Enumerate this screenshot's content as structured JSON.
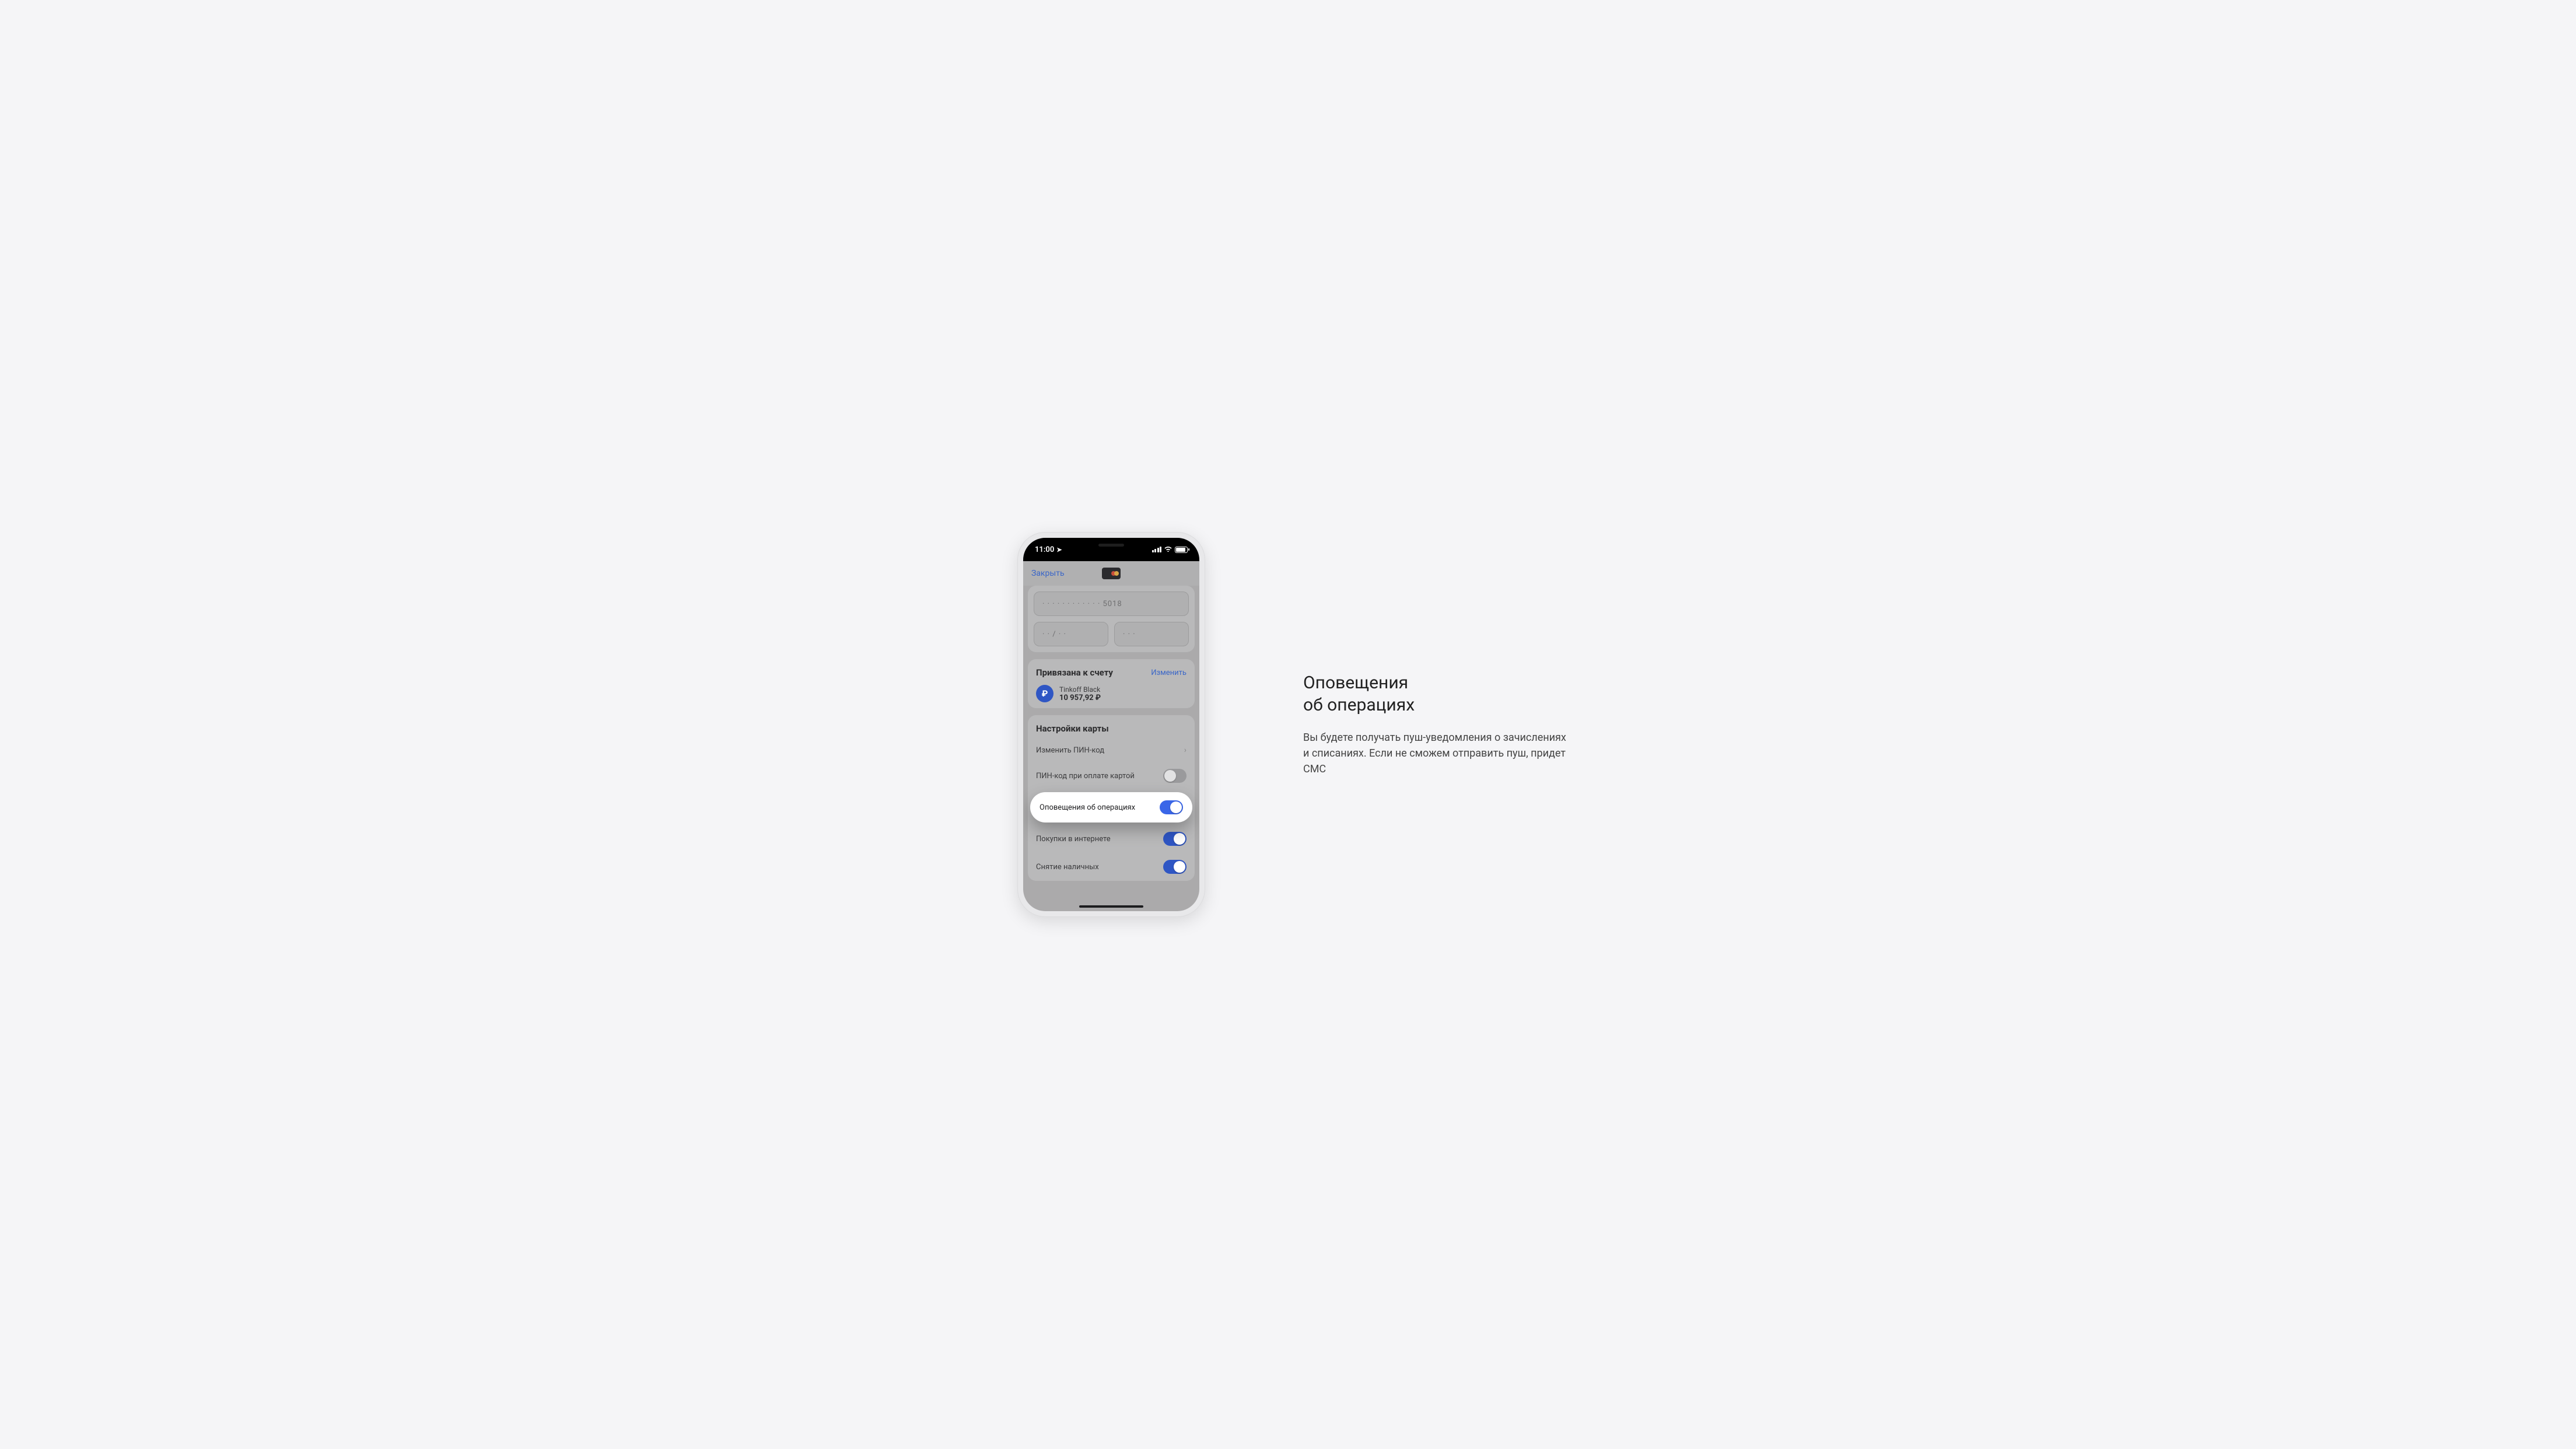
{
  "status": {
    "time": "11:00"
  },
  "nav": {
    "close_label": "Закрыть"
  },
  "card": {
    "pan_masked": "· · · ·   · · · ·   · · · · 5018",
    "expiry_masked": "· · / · ·",
    "cvv_masked": "· · ·"
  },
  "linked": {
    "title": "Привязана к счету",
    "change_label": "Изменить",
    "ruble_symbol": "₽",
    "account_name": "Tinkoff Black",
    "balance": "10 957,92 ₽"
  },
  "settings": {
    "title": "Настройки карты",
    "change_pin": "Изменить ПИН-код",
    "pin_on_pay": "ПИН-код при оплате картой",
    "notifications": "Оповещения об операциях",
    "online_purchases": "Покупки в интернете",
    "cash_withdrawal": "Снятие наличных"
  },
  "info": {
    "title_line1": "Оповещения",
    "title_line2": "об операциях",
    "description": "Вы будете получать пуш-уведомления о зачислениях и списаниях. Если не сможем отправить пуш, придет СМС"
  }
}
